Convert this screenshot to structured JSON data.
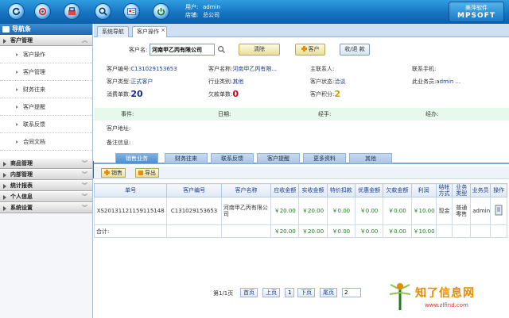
{
  "toolbar": {
    "icons": [
      "refresh-icon",
      "target-icon",
      "bag-icon",
      "search-icon",
      "user-card-icon",
      "power-icon"
    ]
  },
  "user": {
    "user_label": "用户:",
    "user_value": "admin",
    "shop_label": "店铺:",
    "shop_value": "总公司"
  },
  "brand": {
    "cn": "美萍软件",
    "en": "MPSOFT"
  },
  "nav": {
    "header": "导航条",
    "groups": [
      {
        "label": "客户管理",
        "items": [
          "客户操作",
          "客户管理",
          "财务往来",
          "客户提醒",
          "联系反馈",
          "合同文档"
        ]
      },
      {
        "label": "商品管理"
      },
      {
        "label": "内部管理"
      },
      {
        "label": "统计报表"
      },
      {
        "label": "个人信息"
      },
      {
        "label": "系统设置"
      }
    ]
  },
  "tabs": {
    "t1": "系统导航",
    "t2": "客户操作"
  },
  "search": {
    "label": "客户名:",
    "value": "河南甲乙丙有限公司",
    "clear_label": "清除",
    "add_label": "客户",
    "more_label": "收/退 款"
  },
  "info": {
    "row1": {
      "code_label": "客户编号:",
      "code": "C131029153653",
      "name_label": "客户名称:",
      "name": "河南甲乙丙有限...",
      "contact_label": "主联系人:",
      "phone_label": "联系手机:"
    },
    "row2": {
      "type_label": "客户类型:",
      "type": "正式客户",
      "industry_label": "行业类别:",
      "industry": "其他",
      "status_label": "客户状态:",
      "status": "洽谈",
      "sales_label": "此业务员:",
      "sales": "admin ..."
    },
    "row3": {
      "count_label": "消费单数:",
      "count": "20",
      "owe_label": "欠款单数:",
      "owe": "0",
      "points_label": "客户积分:",
      "points": "2"
    },
    "green": {
      "event_label": "事件:",
      "date_label": "日期:",
      "charger_label": "经手:",
      "worker_label": "经办:"
    },
    "row5": {
      "address_label": "客户地址:"
    },
    "row6": {
      "note_label": "备注信息:"
    }
  },
  "section_tabs": [
    "销售业务",
    "财务往来",
    "联系反馈",
    "客户提醒",
    "更多资料",
    "其他"
  ],
  "actions": {
    "sell": "销售",
    "export": "导出"
  },
  "grid": {
    "headers": [
      "单号",
      "客户编号",
      "客户名称",
      "应收金额",
      "实收金额",
      "特价扣款",
      "优惠金额",
      "欠款金额",
      "利润",
      "结帐方式",
      "业务类型",
      "业务员",
      "操作"
    ],
    "rows": [
      [
        "XS20131121159115148",
        "C131029153653",
        "河南甲乙丙有限公司",
        "￥20.00",
        "￥20.00",
        "￥0.00",
        "￥0.00",
        "￥0.00",
        "￥10.00",
        "现金",
        "普通零售",
        "admin",
        ""
      ]
    ],
    "total": {
      "label": "合计:",
      "values": [
        "￥20.00",
        "￥20.00",
        "￥0.00",
        "￥0.00",
        "￥0.00",
        "￥10.00"
      ]
    }
  },
  "pager": {
    "info": "第1/1页",
    "first": "首页",
    "prev": "上页",
    "page_num": "1",
    "next": "下页",
    "last": "尾页",
    "input_value": "2"
  },
  "watermark": {
    "cn": "知了信息网",
    "url": "www.zlfind.com"
  }
}
